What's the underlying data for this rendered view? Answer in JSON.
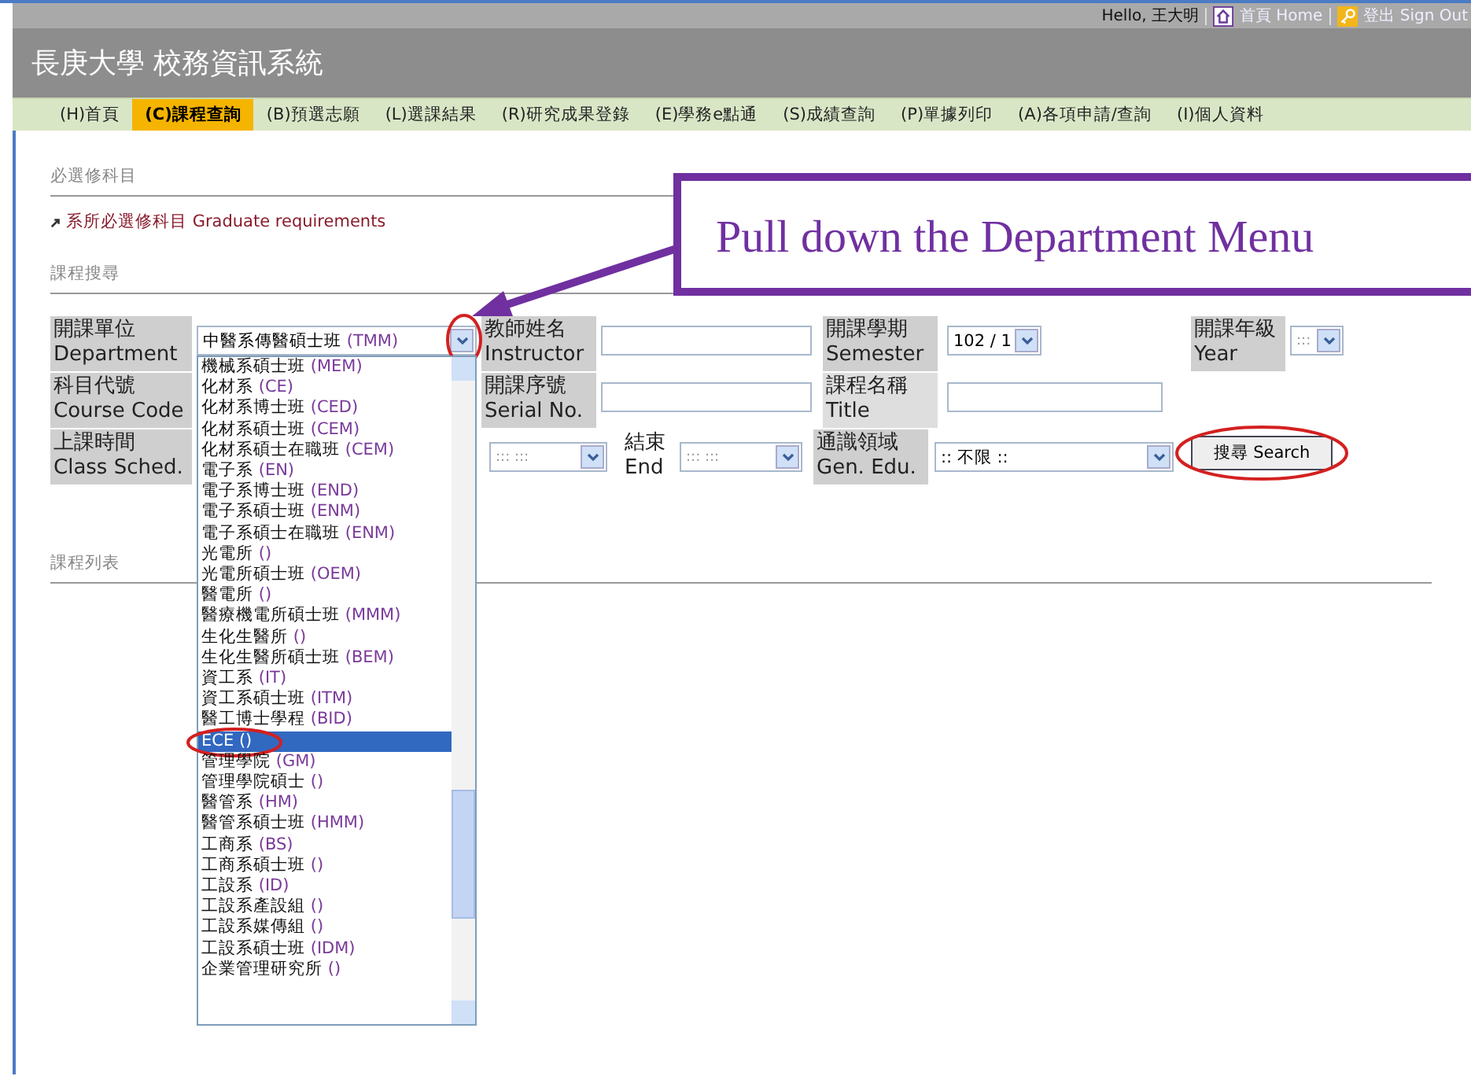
{
  "header": {
    "greeting": "Hello, 王大明",
    "home_link": "首頁 Home",
    "signout_link": "登出 Sign Out",
    "title": "長庚大學 校務資訊系統"
  },
  "nav_tabs": [
    {
      "label": "(H)首頁",
      "selected": false
    },
    {
      "label": "(C)課程查詢",
      "selected": true
    },
    {
      "label": "(B)預選志願",
      "selected": false
    },
    {
      "label": "(L)選課結果",
      "selected": false
    },
    {
      "label": "(R)研究成果登錄",
      "selected": false
    },
    {
      "label": "(E)學務e點通",
      "selected": false
    },
    {
      "label": "(S)成績查詢",
      "selected": false
    },
    {
      "label": "(P)單據列印",
      "selected": false
    },
    {
      "label": "(A)各項申請/查詢",
      "selected": false
    },
    {
      "label": "(I)個人資料",
      "selected": false
    }
  ],
  "required_section": {
    "heading": "必選修科目",
    "link": "系所必選修科目 Graduate requirements"
  },
  "search_section": {
    "heading": "課程搜尋",
    "department": {
      "label_zh": "開課單位",
      "label_en": "Department",
      "value": "中醫系傳醫碩士班",
      "value_code": "(TMM)"
    },
    "instructor": {
      "label_zh": "教師姓名",
      "label_en": "Instructor"
    },
    "semester": {
      "label_zh": "開課學期",
      "label_en": "Semester",
      "value": "102 / 1"
    },
    "year": {
      "label_zh": "開課年級",
      "label_en": "Year",
      "value": ":::"
    },
    "course_code": {
      "label_zh": "科目代號",
      "label_en": "Course Code"
    },
    "serial_no": {
      "label_zh": "開課序號",
      "label_en": "Serial No."
    },
    "title": {
      "label_zh": "課程名稱",
      "label_en": "Title"
    },
    "class_sched": {
      "label_zh": "上課時間",
      "label_en": "Class Sched.",
      "start_value": "::: :::"
    },
    "end": {
      "label_zh": "結束",
      "label_en": "End",
      "value": "::: :::"
    },
    "gen_edu": {
      "label_zh": "通識領域",
      "label_en": "Gen. Edu.",
      "value": ":: 不限 ::"
    },
    "search_button": "搜尋 Search"
  },
  "list_section": {
    "heading": "課程列表"
  },
  "department_options": [
    {
      "name": "機械系碩士班",
      "code": "(MEM)",
      "selected": false
    },
    {
      "name": "化材系",
      "code": "(CE)",
      "selected": false
    },
    {
      "name": "化材系博士班",
      "code": "(CED)",
      "selected": false
    },
    {
      "name": "化材系碩士班",
      "code": "(CEM)",
      "selected": false
    },
    {
      "name": "化材系碩士在職班",
      "code": "(CEM)",
      "selected": false
    },
    {
      "name": "電子系",
      "code": "(EN)",
      "selected": false
    },
    {
      "name": "電子系博士班",
      "code": "(END)",
      "selected": false
    },
    {
      "name": "電子系碩士班",
      "code": "(ENM)",
      "selected": false
    },
    {
      "name": "電子系碩士在職班",
      "code": "(ENM)",
      "selected": false
    },
    {
      "name": "光電所",
      "code": "()",
      "selected": false
    },
    {
      "name": "光電所碩士班",
      "code": "(OEM)",
      "selected": false
    },
    {
      "name": "醫電所",
      "code": "()",
      "selected": false
    },
    {
      "name": "醫療機電所碩士班",
      "code": "(MMM)",
      "selected": false
    },
    {
      "name": "生化生醫所",
      "code": "()",
      "selected": false
    },
    {
      "name": "生化生醫所碩士班",
      "code": "(BEM)",
      "selected": false
    },
    {
      "name": "資工系",
      "code": "(IT)",
      "selected": false
    },
    {
      "name": "資工系碩士班",
      "code": "(ITM)",
      "selected": false
    },
    {
      "name": "醫工博士學程",
      "code": "(BID)",
      "selected": false
    },
    {
      "name": "ECE",
      "code": "()",
      "selected": true
    },
    {
      "name": "管理學院",
      "code": "(GM)",
      "selected": false
    },
    {
      "name": "管理學院碩士",
      "code": "()",
      "selected": false
    },
    {
      "name": "醫管系",
      "code": "(HM)",
      "selected": false
    },
    {
      "name": "醫管系碩士班",
      "code": "(HMM)",
      "selected": false
    },
    {
      "name": "工商系",
      "code": "(BS)",
      "selected": false
    },
    {
      "name": "工商系碩士班",
      "code": "()",
      "selected": false
    },
    {
      "name": "工設系",
      "code": "(ID)",
      "selected": false
    },
    {
      "name": "工設系產設組",
      "code": "()",
      "selected": false
    },
    {
      "name": "工設系媒傳組",
      "code": "()",
      "selected": false
    },
    {
      "name": "工設系碩士班",
      "code": "(IDM)",
      "selected": false
    },
    {
      "name": "企業管理研究所",
      "code": "()",
      "selected": false
    }
  ],
  "callout": {
    "text": "Pull down the Department Menu"
  }
}
